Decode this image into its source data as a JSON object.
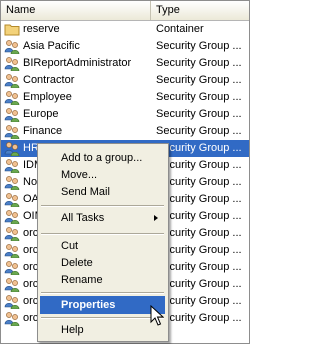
{
  "columns": {
    "name": "Name",
    "type": "Type"
  },
  "rows": [
    {
      "name": "reserve",
      "type": "Container",
      "icon": "folder-icon"
    },
    {
      "name": "Asia Pacific",
      "type": "Security Group ...",
      "icon": "group-icon"
    },
    {
      "name": "BIReportAdministrator",
      "type": "Security Group ...",
      "icon": "group-icon"
    },
    {
      "name": "Contractor",
      "type": "Security Group ...",
      "icon": "group-icon"
    },
    {
      "name": "Employee",
      "type": "Security Group ...",
      "icon": "group-icon"
    },
    {
      "name": "Europe",
      "type": "Security Group ...",
      "icon": "group-icon"
    },
    {
      "name": "Finance",
      "type": "Security Group ...",
      "icon": "group-icon"
    },
    {
      "name": "HR",
      "type": "Security Group ...",
      "icon": "group-icon",
      "selected": true
    },
    {
      "name": "IDM",
      "type": "Security Group ...",
      "icon": "group-icon"
    },
    {
      "name": "Nor",
      "type": "Security Group ...",
      "icon": "group-icon"
    },
    {
      "name": "OAM",
      "type": "Security Group ...",
      "icon": "group-icon"
    },
    {
      "name": "OIM",
      "type": "Security Group ...",
      "icon": "group-icon"
    },
    {
      "name": "orcl",
      "type": "Security Group ...",
      "icon": "group-icon"
    },
    {
      "name": "orcl",
      "type": "Security Group ...",
      "icon": "group-icon"
    },
    {
      "name": "orcl",
      "type": "Security Group ...",
      "icon": "group-icon"
    },
    {
      "name": "orcl",
      "type": "Security Group ...",
      "icon": "group-icon"
    },
    {
      "name": "orcl",
      "type": "Security Group ...",
      "icon": "group-icon"
    },
    {
      "name": "orcl",
      "type": "Security Group ...",
      "icon": "group-icon"
    }
  ],
  "context_menu": {
    "add_to_group": "Add to a group...",
    "move": "Move...",
    "send_mail": "Send Mail",
    "all_tasks": "All Tasks",
    "cut": "Cut",
    "delete": "Delete",
    "rename": "Rename",
    "properties": "Properties",
    "help": "Help"
  },
  "colors": {
    "selection": "#316ac5",
    "menu_background": "#f1efe2"
  }
}
